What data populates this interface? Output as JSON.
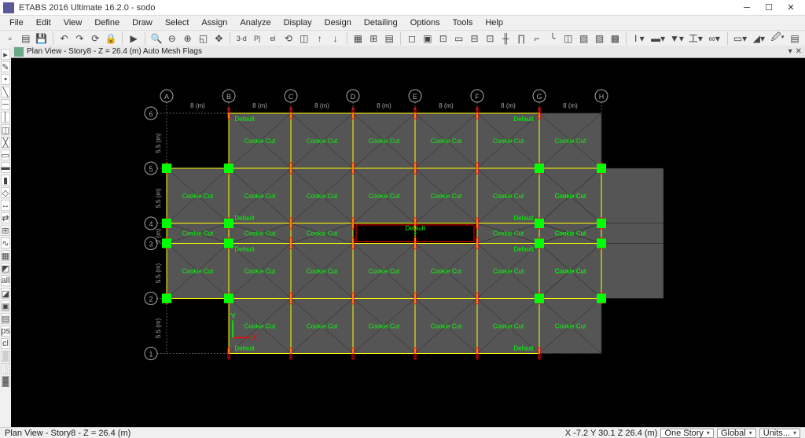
{
  "app": {
    "title": "ETABS 2016 Ultimate 16.2.0 - sodo"
  },
  "menu": {
    "items": [
      "File",
      "Edit",
      "View",
      "Define",
      "Draw",
      "Select",
      "Assign",
      "Analyze",
      "Display",
      "Design",
      "Detailing",
      "Options",
      "Tools",
      "Help"
    ]
  },
  "view": {
    "title": "Plan View - Story8 - Z = 26.4 (m)  Auto Mesh Flags"
  },
  "status": {
    "left": "Plan View - Story8 - Z = 26.4 (m)",
    "coords": "X -7.2  Y 30.1  Z 26.4 (m)",
    "sel1": "One Story",
    "sel2": "Global",
    "sel3": "Units..."
  },
  "grid": {
    "cols": [
      "A",
      "B",
      "C",
      "D",
      "E",
      "F",
      "G",
      "H"
    ],
    "rows": [
      "6",
      "5",
      "4",
      "3",
      "2",
      "1"
    ],
    "coldim": "8 (m)",
    "rowdims": [
      "5.5 (m)",
      "5.5 (m)",
      "2 (m)",
      "5.5 (m)",
      "5.5 (m)"
    ]
  },
  "labels": {
    "cookie": "Cookie Cut",
    "default": "Default"
  },
  "colors": {
    "bg": "#000000",
    "grid": "#aaaaaa",
    "yellow": "#ffff00",
    "red": "#ff0000",
    "green": "#00ff00",
    "slab": "#555555"
  }
}
